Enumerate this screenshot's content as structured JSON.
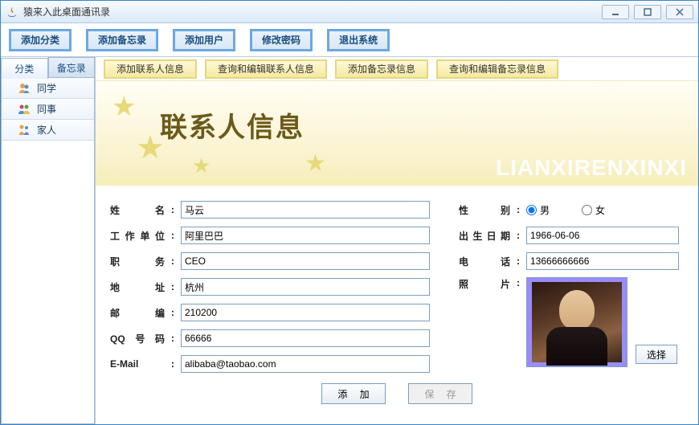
{
  "window": {
    "title": "猿来入此桌面通讯录"
  },
  "toolbar": {
    "add_category": "添加分类",
    "add_memo": "添加备忘录",
    "add_user": "添加用户",
    "change_password": "修改密码",
    "exit_system": "退出系统"
  },
  "sidebar": {
    "tabs": {
      "category": "分类",
      "memo": "备忘录"
    },
    "items": [
      {
        "label": "同学"
      },
      {
        "label": "同事"
      },
      {
        "label": "家人"
      }
    ]
  },
  "subtabs": {
    "add_contact": "添加联系人信息",
    "query_edit_contact": "查询和编辑联系人信息",
    "add_memo": "添加备忘录信息",
    "query_edit_memo": "查询和编辑备忘录信息"
  },
  "banner": {
    "title": "联系人信息",
    "subtitle": "LIANXIRENXINXI"
  },
  "form": {
    "labels": {
      "name": "姓 名",
      "workplace": "工作单位",
      "position": "职 务",
      "address": "地 址",
      "postcode": "邮 编",
      "qq": "QQ号码",
      "email": "E-Mail",
      "gender": "性 别",
      "birthday": "出生日期",
      "phone": "电 话",
      "photo": "照 片"
    },
    "gender_options": {
      "male": "男",
      "female": "女"
    },
    "values": {
      "name": "马云",
      "workplace": "阿里巴巴",
      "position": "CEO",
      "address": "杭州",
      "postcode": "210200",
      "qq": "66666",
      "email": "alibaba@taobao.com",
      "gender": "male",
      "birthday": "1966-06-06",
      "phone": "13666666666"
    },
    "buttons": {
      "choose": "选择",
      "add": "添 加",
      "save": "保 存"
    }
  }
}
